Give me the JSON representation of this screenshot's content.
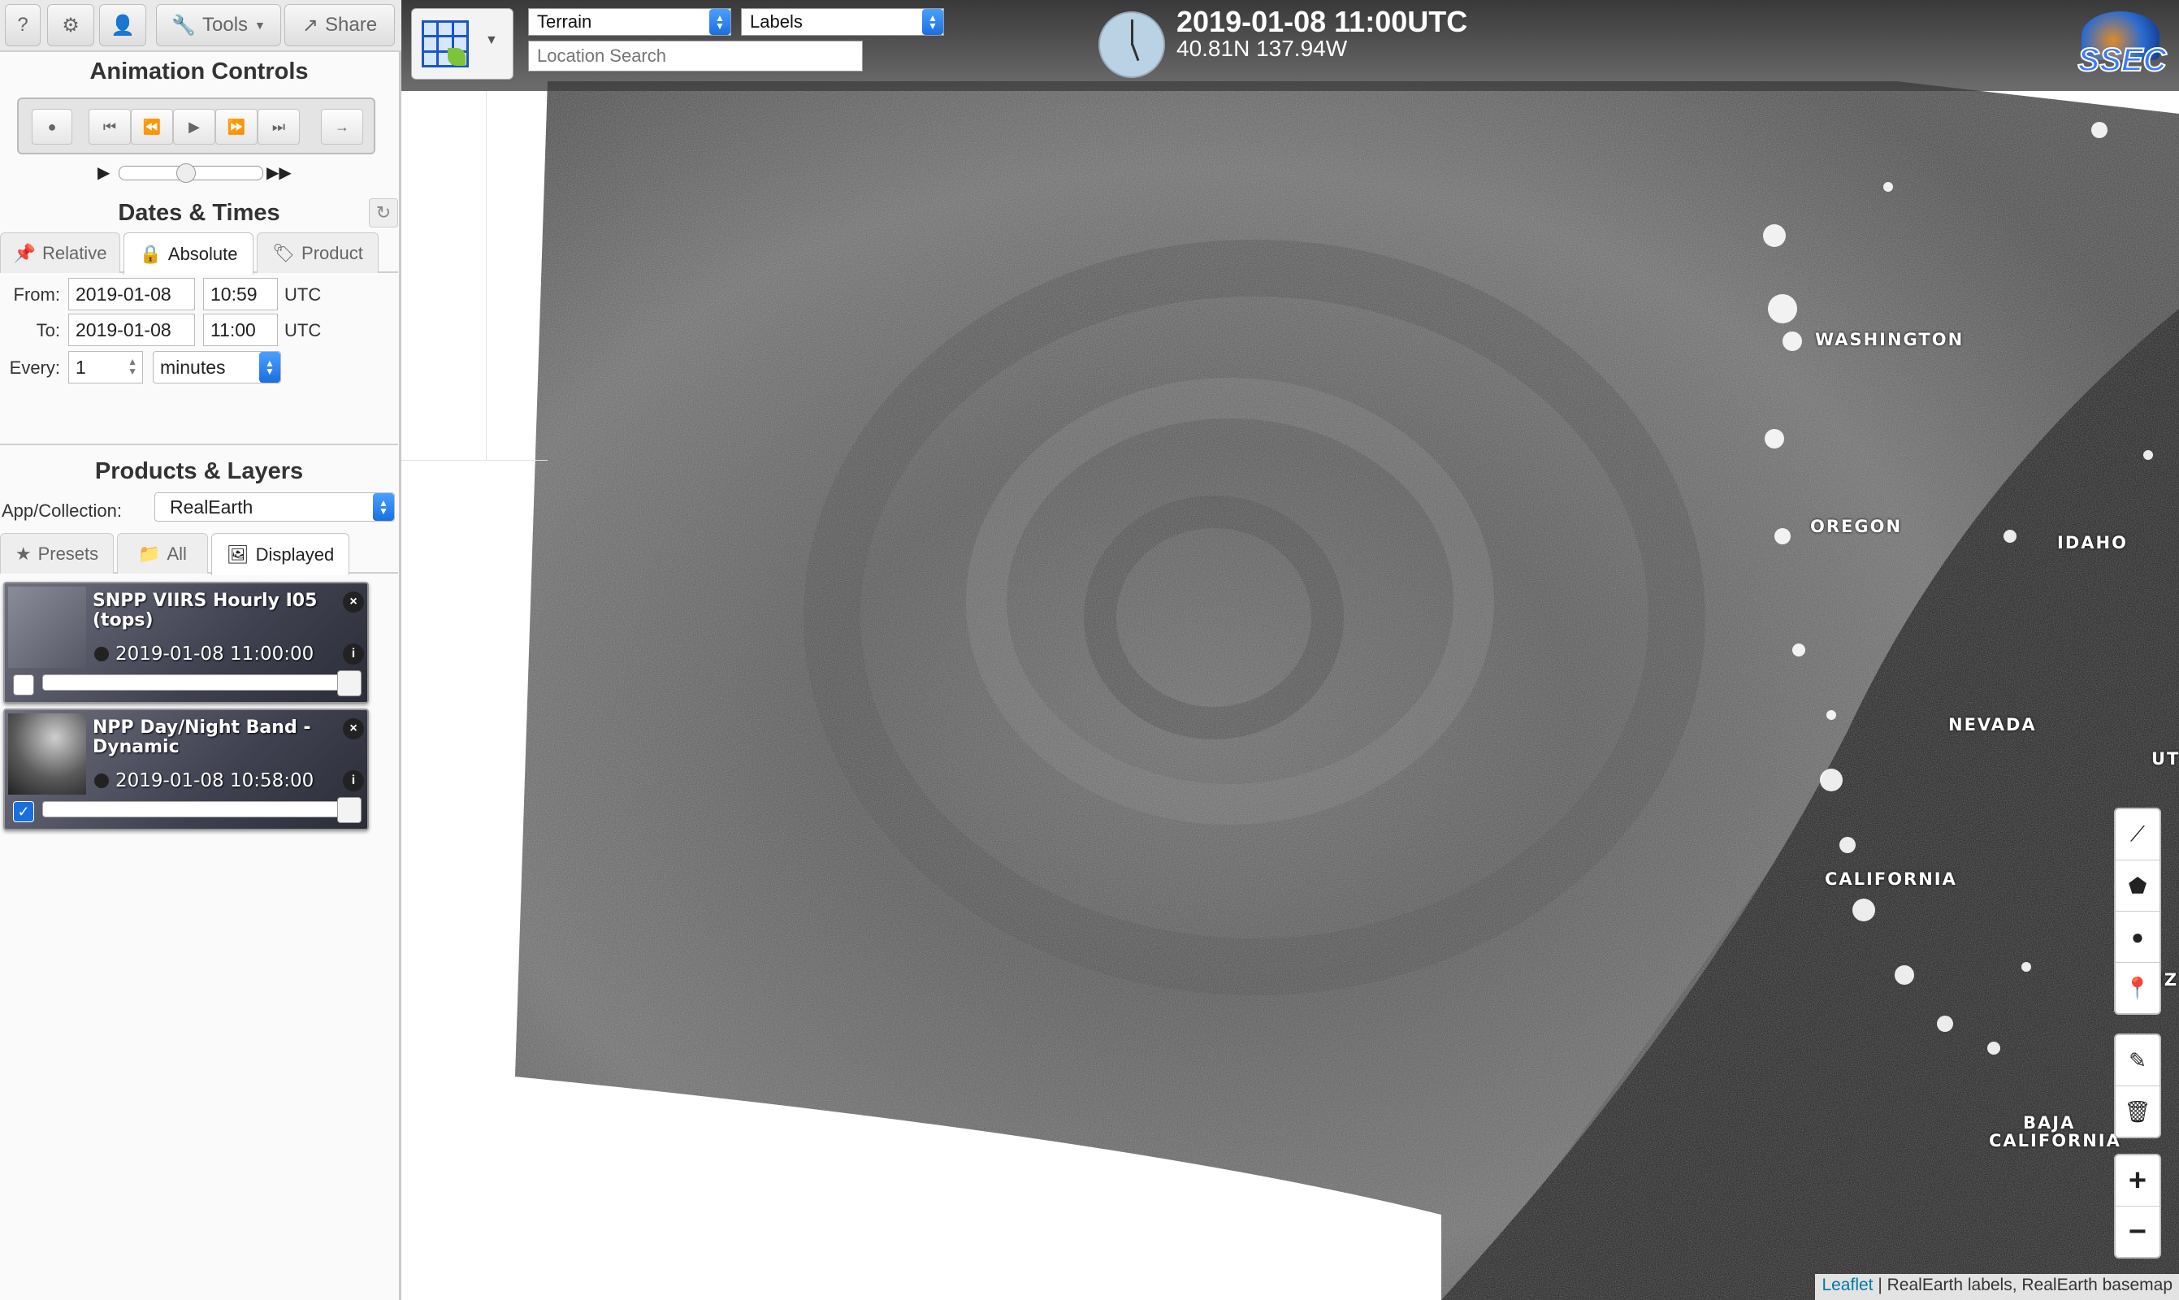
{
  "toolbar": {
    "help": "?",
    "tools_label": "Tools",
    "share_label": "Share"
  },
  "animation": {
    "title": "Animation Controls"
  },
  "dates": {
    "title": "Dates & Times",
    "tabs": [
      "Relative",
      "Absolute",
      "Product"
    ],
    "from_label": "From:",
    "from_date": "2019-01-08",
    "from_time": "10:59",
    "to_label": "To:",
    "to_date": "2019-01-08",
    "to_time": "11:00",
    "utc": "UTC",
    "every_label": "Every:",
    "every_value": "1",
    "every_unit": "minutes"
  },
  "products": {
    "title": "Products & Layers",
    "collection_label": "App/Collection:",
    "collection_value": "RealEarth",
    "tabs": [
      "Presets",
      "All",
      "Displayed"
    ]
  },
  "layers": [
    {
      "title": "SNPP VIIRS Hourly I05 (tops)",
      "time": "2019-01-08 11:00:00",
      "checked": false
    },
    {
      "title": "NPP Day/Night Band - Dynamic",
      "time": "2019-01-08 10:58:00",
      "checked": true
    }
  ],
  "map": {
    "basemap": "Terrain",
    "labels": "Labels",
    "search_placeholder": "Location Search",
    "datetime": "2019-01-08 11:00UTC",
    "coords": "40.81N 137.94W",
    "logo": "SSEC",
    "places": [
      "WASHINGTON",
      "OREGON",
      "IDAHO",
      "NEVADA",
      "CALIFORNIA",
      "BAJA",
      "CALIFORNIA",
      "UT",
      "IZ"
    ],
    "attribution_link": "Leaflet",
    "attribution_text": " | RealEarth labels, RealEarth basemap"
  },
  "colors": {
    "accent": "#1a6fe0",
    "panel": "#fafafa",
    "night": "#1a1a1a"
  }
}
